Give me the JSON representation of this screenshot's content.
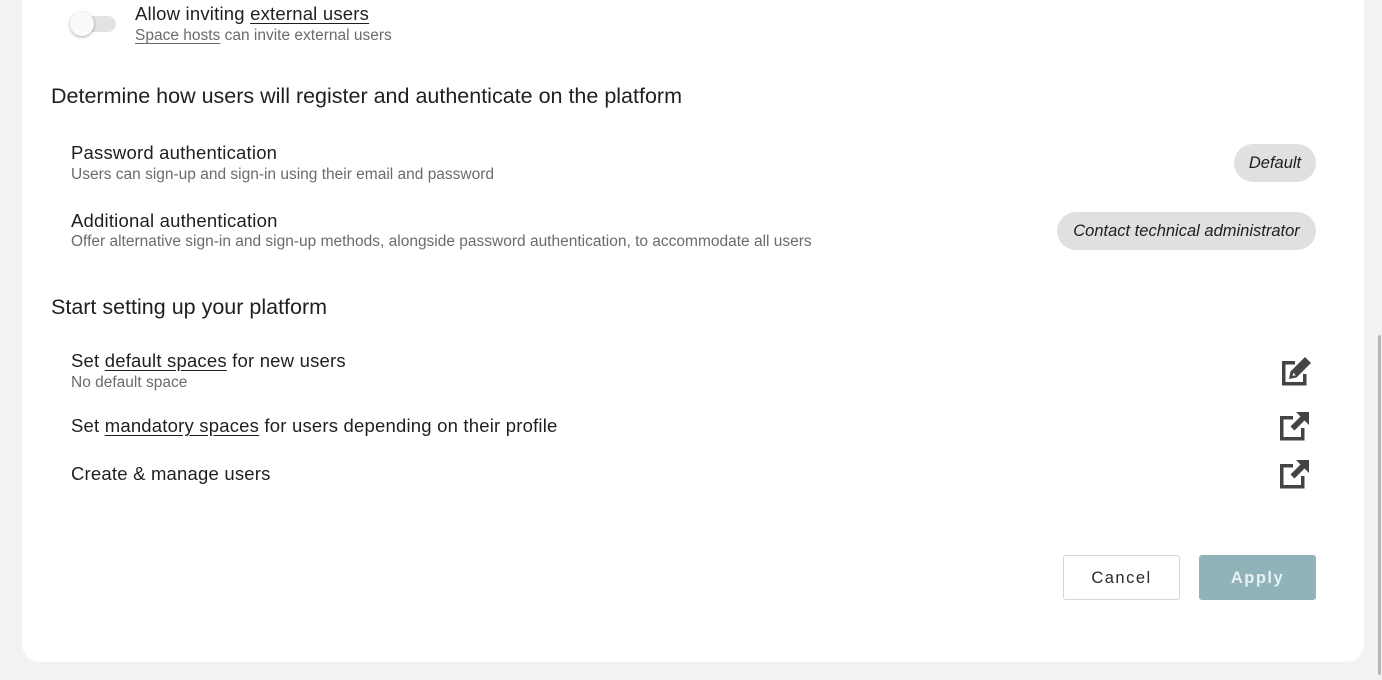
{
  "external_users": {
    "title_prefix": "Allow inviting ",
    "title_link": "external users",
    "sub_link": "Space hosts",
    "sub_rest": " can invite external users",
    "toggle_on": false
  },
  "auth_section": {
    "heading": "Determine how users will register and authenticate on the platform",
    "password": {
      "title": "Password authentication",
      "description": "Users can sign-up and sign-in using their email and password",
      "badge": "Default"
    },
    "additional": {
      "title": "Additional authentication",
      "description": "Offer alternative sign-in and sign-up methods, alongside password authentication, to accommodate all users",
      "badge": "Contact technical administrator"
    }
  },
  "setup_section": {
    "heading": "Start setting up your platform",
    "default_spaces": {
      "prefix": "Set ",
      "link": "default spaces",
      "suffix": " for new users",
      "description": "No default space",
      "icon": "edit-icon"
    },
    "mandatory_spaces": {
      "prefix": "Set ",
      "link": "mandatory spaces",
      "suffix": " for users depending on their profile",
      "icon": "external-link-icon"
    },
    "manage_users": {
      "title": "Create & manage users",
      "icon": "external-link-icon"
    }
  },
  "actions": {
    "cancel": "Cancel",
    "apply": "Apply"
  },
  "colors": {
    "apply_bg": "#8fb3b8",
    "badge_bg": "#e0e0e0",
    "page_bg": "#f2f2f2"
  }
}
